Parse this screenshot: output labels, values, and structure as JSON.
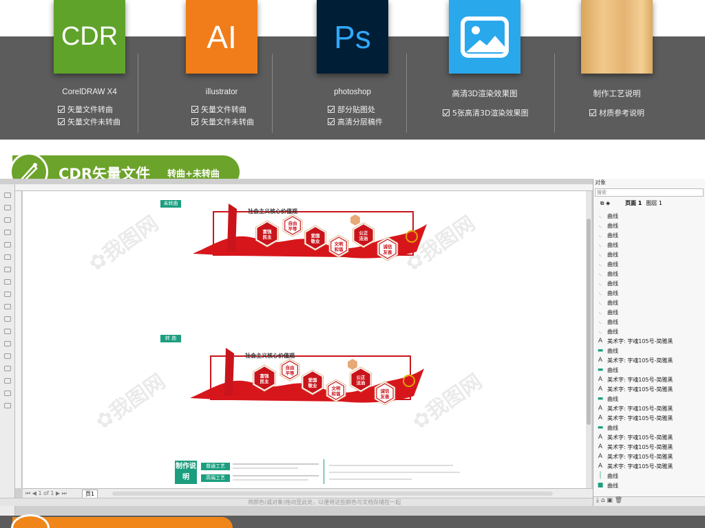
{
  "software_cards": [
    {
      "icon": "cdr-logo-icon",
      "label": "CDR",
      "color": "#5fa32b",
      "title": "CorelDRAW X4",
      "features": [
        "矢量文件转曲",
        "矢量文件未转曲"
      ]
    },
    {
      "icon": "ai-logo-icon",
      "label": "AI",
      "color": "#f07d1a",
      "title": "illustrator",
      "features": [
        "矢量文件转曲",
        "矢量文件未转曲"
      ]
    },
    {
      "icon": "ps-logo-icon",
      "label": "Ps",
      "color": "#001e36",
      "title": "photoshop",
      "features": [
        "部分贴图处",
        "高清分层稿件"
      ]
    },
    {
      "icon": "image-icon",
      "label": "",
      "color": "#2aa8ec",
      "title": "高清3D渲染效果图",
      "features": [
        "5张高清3D渲染效果图"
      ]
    },
    {
      "icon": "wood-texture-icon",
      "label": "",
      "color": "#e7b972",
      "title": "制作工艺说明",
      "features": [
        "材质参考说明"
      ]
    }
  ],
  "section_header": {
    "title": "CDR矢量文件",
    "subtitle": "转曲+未转曲",
    "color": "#6ca32a"
  },
  "canvas": {
    "tag_unconverted": "未转曲",
    "tag_converted": "转 曲",
    "banner_title": "社会主义核心价值观",
    "values": [
      "富强民主",
      "自由平等",
      "爱国敬业",
      "文明和谐",
      "公正法治",
      "诚信友善"
    ],
    "craft_label": "制作说明",
    "craft_items": [
      "普通工艺",
      "高端工艺"
    ],
    "page_tab": "页1",
    "status_hint": "将颜色(或对象)拖动至此处，以便将这些颜色与文档存储在一起"
  },
  "object_panel": {
    "header": "对象",
    "search_placeholder": "搜索",
    "page_label": "页面 1",
    "layer_label": "图层 1",
    "rows": [
      {
        "type": "curve-icon",
        "label": "曲线"
      },
      {
        "type": "curve-icon",
        "label": "曲线"
      },
      {
        "type": "curve-icon",
        "label": "曲线"
      },
      {
        "type": "curve-icon",
        "label": "曲线"
      },
      {
        "type": "curve-icon",
        "label": "曲线"
      },
      {
        "type": "curve-icon",
        "label": "曲线"
      },
      {
        "type": "curve-icon",
        "label": "曲线"
      },
      {
        "type": "curve-icon",
        "label": "曲线"
      },
      {
        "type": "curve-icon",
        "label": "曲线"
      },
      {
        "type": "curve-icon",
        "label": "曲线"
      },
      {
        "type": "curve-icon",
        "label": "曲线"
      },
      {
        "type": "curve-icon",
        "label": "曲线"
      },
      {
        "type": "curve-icon",
        "label": "曲线"
      },
      {
        "type": "text-icon",
        "label": "美术字: 字魂105号-简雅黑"
      },
      {
        "type": "bar-icon",
        "label": "曲线"
      },
      {
        "type": "text-icon",
        "label": "美术字: 字魂105号-简雅黑"
      },
      {
        "type": "bar-icon",
        "label": "曲线"
      },
      {
        "type": "text-icon",
        "label": "美术字: 字魂105号-简雅黑"
      },
      {
        "type": "text-icon",
        "label": "美术字: 字魂105号-简雅黑"
      },
      {
        "type": "bar-icon",
        "label": "曲线"
      },
      {
        "type": "text-icon",
        "label": "美术字: 字魂105号-简雅黑"
      },
      {
        "type": "text-icon",
        "label": "美术字: 字魂105号-简雅黑"
      },
      {
        "type": "bar-icon",
        "label": "曲线"
      },
      {
        "type": "text-icon",
        "label": "美术字: 字魂105号-简雅黑"
      },
      {
        "type": "text-icon",
        "label": "美术字: 字魂105号-简雅黑"
      },
      {
        "type": "text-icon",
        "label": "美术字: 字魂105号-简雅黑"
      },
      {
        "type": "text-icon",
        "label": "美术字: 字魂105号-简雅黑"
      },
      {
        "type": "line-icon",
        "label": "曲线"
      },
      {
        "type": "box-icon",
        "label": "曲线"
      }
    ]
  }
}
